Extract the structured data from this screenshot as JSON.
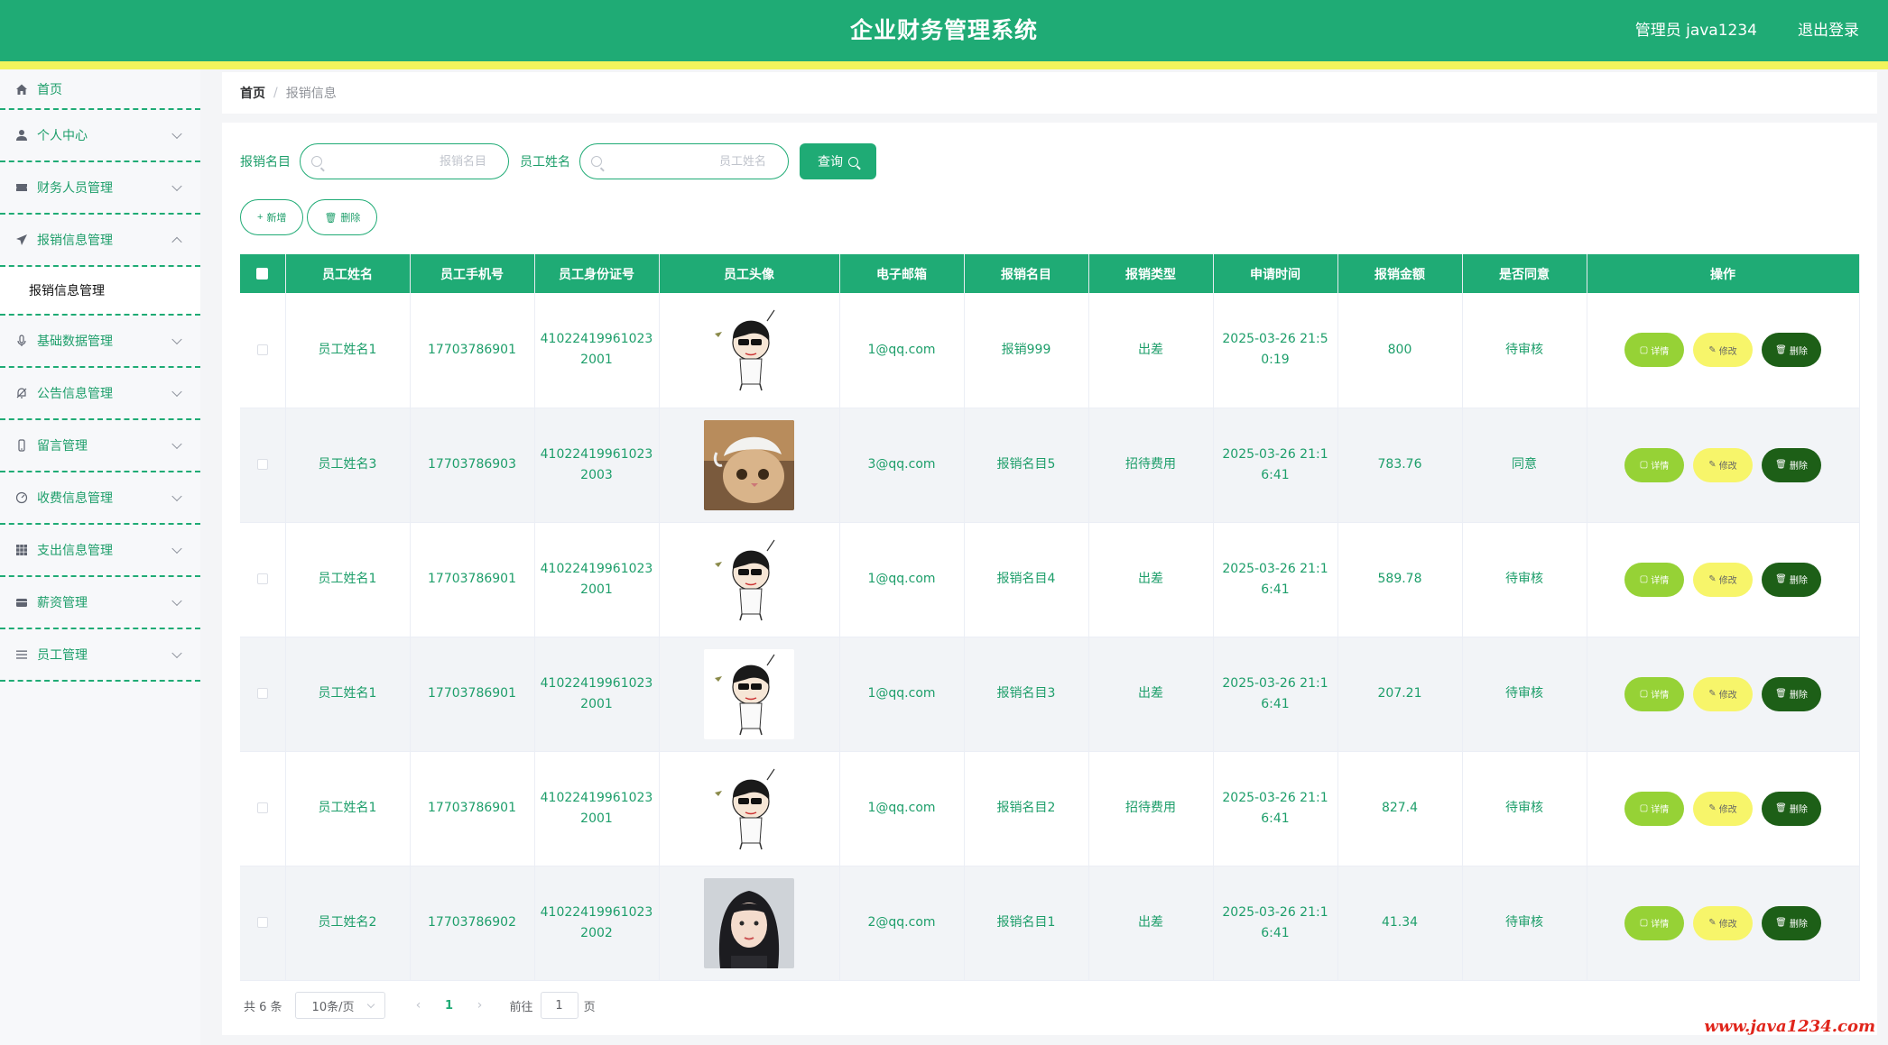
{
  "header": {
    "title": "企业财务管理系统",
    "admin": "管理员 java1234",
    "logout": "退出登录"
  },
  "sidebar": {
    "items": [
      {
        "label": "首页",
        "icon": "home-icon",
        "expandable": false
      },
      {
        "label": "个人中心",
        "icon": "user-icon",
        "expandable": true
      },
      {
        "label": "财务人员管理",
        "icon": "ticket-icon",
        "expandable": true
      },
      {
        "label": "报销信息管理",
        "icon": "send-icon",
        "expandable": true,
        "expanded": true
      },
      {
        "label": "基础数据管理",
        "icon": "microphone-icon",
        "expandable": true
      },
      {
        "label": "公告信息管理",
        "icon": "bell-icon",
        "expandable": true
      },
      {
        "label": "留言管理",
        "icon": "mobile-icon",
        "expandable": true
      },
      {
        "label": "收费信息管理",
        "icon": "speedometer-icon",
        "expandable": true
      },
      {
        "label": "支出信息管理",
        "icon": "grid-icon",
        "expandable": true
      },
      {
        "label": "薪资管理",
        "icon": "wallet-icon",
        "expandable": true
      },
      {
        "label": "员工管理",
        "icon": "menu-icon",
        "expandable": true
      }
    ],
    "submenu": {
      "label": "报销信息管理"
    }
  },
  "breadcrumb": {
    "home": "首页",
    "separator": "/",
    "current": "报销信息"
  },
  "search": {
    "name_label": "报销名目",
    "name_placeholder": "报销名目",
    "employee_label": "员工姓名",
    "employee_placeholder": "员工姓名",
    "query_button": "查询"
  },
  "actions": {
    "add": "新增",
    "delete": "删除"
  },
  "table": {
    "columns": [
      "员工姓名",
      "员工手机号",
      "员工身份证号",
      "员工头像",
      "电子邮箱",
      "报销名目",
      "报销类型",
      "申请时间",
      "报销金额",
      "是否同意",
      "操作"
    ],
    "rows": [
      {
        "name": "员工姓名1",
        "phone": "17703786901",
        "id_card_1": "41022419961023",
        "id_card_2": "2001",
        "avatar": "cartoon-boy",
        "email": "1@qq.com",
        "item": "报销999",
        "type": "出差",
        "time_1": "2025-03-26 21:5",
        "time_2": "0:19",
        "amount": "800",
        "approved": "待审核"
      },
      {
        "name": "员工姓名3",
        "phone": "17703786903",
        "id_card_1": "41022419961023",
        "id_card_2": "2003",
        "avatar": "cat",
        "email": "3@qq.com",
        "item": "报销名目5",
        "type": "招待费用",
        "time_1": "2025-03-26 21:1",
        "time_2": "6:41",
        "amount": "783.76",
        "approved": "同意"
      },
      {
        "name": "员工姓名1",
        "phone": "17703786901",
        "id_card_1": "41022419961023",
        "id_card_2": "2001",
        "avatar": "cartoon-boy",
        "email": "1@qq.com",
        "item": "报销名目4",
        "type": "出差",
        "time_1": "2025-03-26 21:1",
        "time_2": "6:41",
        "amount": "589.78",
        "approved": "待审核"
      },
      {
        "name": "员工姓名1",
        "phone": "17703786901",
        "id_card_1": "41022419961023",
        "id_card_2": "2001",
        "avatar": "cartoon-boy",
        "email": "1@qq.com",
        "item": "报销名目3",
        "type": "出差",
        "time_1": "2025-03-26 21:1",
        "time_2": "6:41",
        "amount": "207.21",
        "approved": "待审核"
      },
      {
        "name": "员工姓名1",
        "phone": "17703786901",
        "id_card_1": "41022419961023",
        "id_card_2": "2001",
        "avatar": "cartoon-boy",
        "email": "1@qq.com",
        "item": "报销名目2",
        "type": "招待费用",
        "time_1": "2025-03-26 21:1",
        "time_2": "6:41",
        "amount": "827.4",
        "approved": "待审核"
      },
      {
        "name": "员工姓名2",
        "phone": "17703786902",
        "id_card_1": "41022419961023",
        "id_card_2": "2002",
        "avatar": "girl-photo",
        "email": "2@qq.com",
        "item": "报销名目1",
        "type": "出差",
        "time_1": "2025-03-26 21:1",
        "time_2": "6:41",
        "amount": "41.34",
        "approved": "待审核"
      }
    ],
    "ops": {
      "detail": "详情",
      "edit": "修改",
      "delete": "删除"
    }
  },
  "pagination": {
    "total": "共 6 条",
    "page_size": "10条/页",
    "current_page": "1",
    "goto_label": "前往",
    "goto_value": "1",
    "goto_unit": "页"
  },
  "watermark": "www.java1234.com",
  "colors": {
    "primary": "#1fab75",
    "stripe": "#f2f45c",
    "detail": "#96d236",
    "edit": "#f7f56a",
    "delete": "#1d5f17"
  }
}
